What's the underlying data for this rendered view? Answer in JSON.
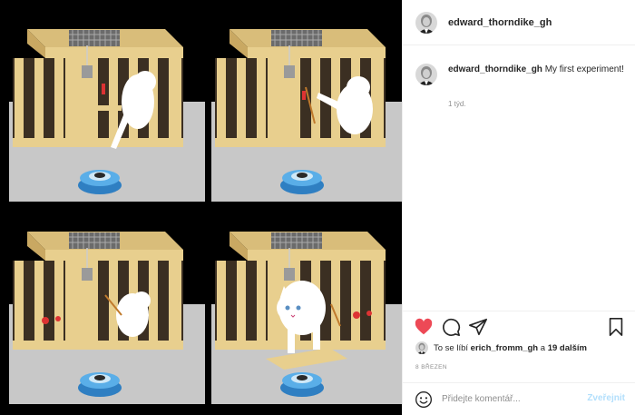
{
  "post": {
    "author": "edward_thorndike_gh",
    "caption_author": "edward_thorndike_gh",
    "caption_text": "My first experiment!",
    "caption_age": "1 týd.",
    "likes_prefix": "To se líbí",
    "likes_user": "erich_fromm_gh",
    "likes_middle": "a",
    "likes_others": "19 dalším",
    "date": "8 BŘEZEN",
    "liked": true
  },
  "comment": {
    "placeholder": "Přidejte komentář...",
    "publish_label": "Zveřejnit"
  },
  "icons": {
    "like": "heart-icon",
    "comment": "comment-bubble-icon",
    "share": "paper-plane-icon",
    "save": "bookmark-icon",
    "emoji": "smiley-icon"
  },
  "colors": {
    "heart": "#ed4956",
    "publish_disabled": "#b2dffc",
    "text": "#262626",
    "muted": "#8e8e8e"
  }
}
